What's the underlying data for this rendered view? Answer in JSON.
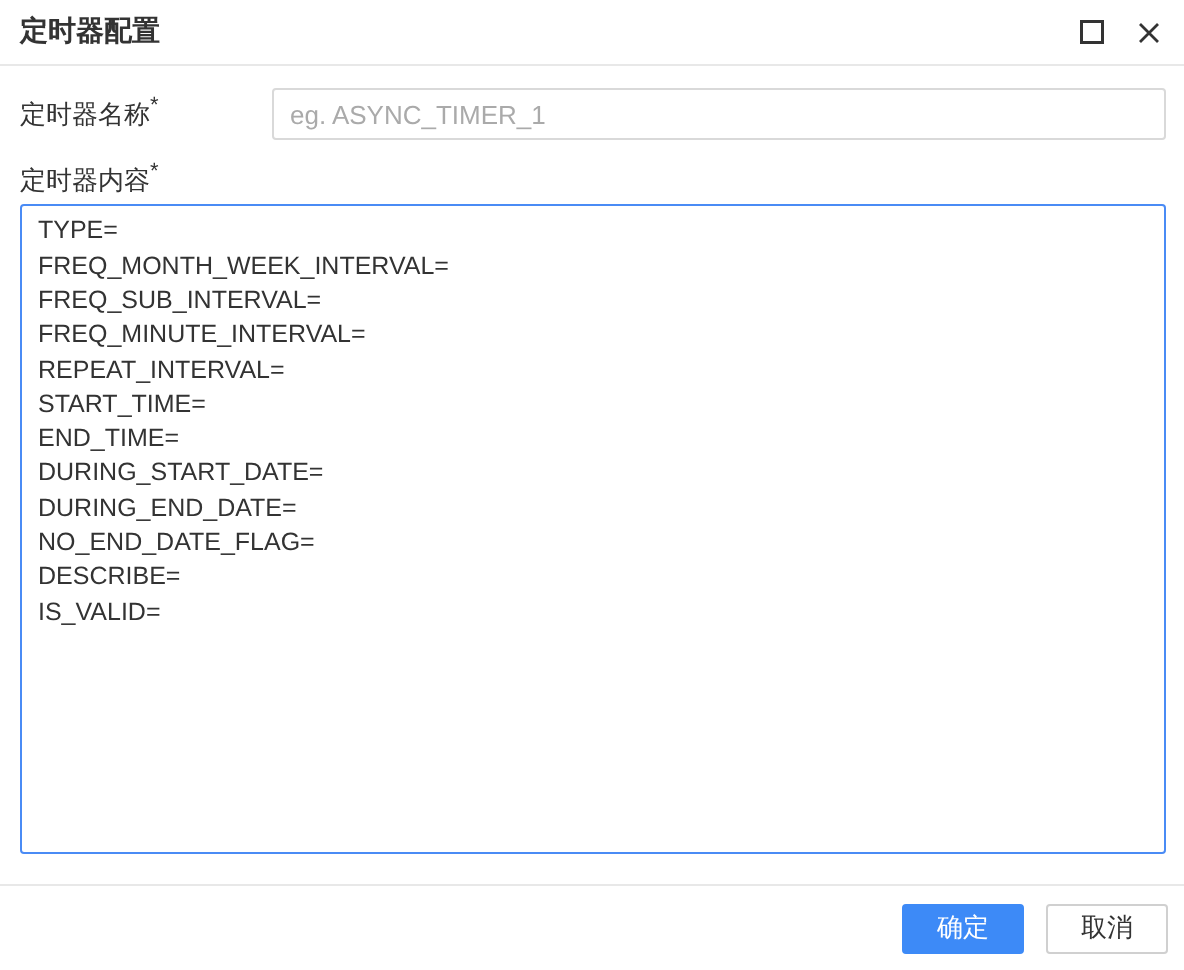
{
  "window": {
    "title": "定时器配置"
  },
  "fields": [
    {
      "kind": "input",
      "label": "定时器名称$^{*}$",
      "placeholder": "eg. ASYNC_TIMER_1"
    },
    {
      "kind": "textarea",
      "label": "定时器内容$^{*}$",
      "value": "TYPE=\nFREQ_MONTH_WEEK_INTERVAL=\nFREQ_SUB_INTERVAL=\nFREQ_MINUTE_INTERVAL=\nREPEAT_INTERVAL=\nSTART_TIME=\nEND_TIME=\nDURING_START_DATE=\nDURING_END_DATE=\nNO_END_DATE_FLAG=\nDESCRIBE=\nIS_VALID=",
      "focused": true
    }
  ],
  "buttons": [
    {
      "label": "确定",
      "kind": "primary"
    },
    {
      "label": "取消",
      "kind": "default"
    }
  ]
}
